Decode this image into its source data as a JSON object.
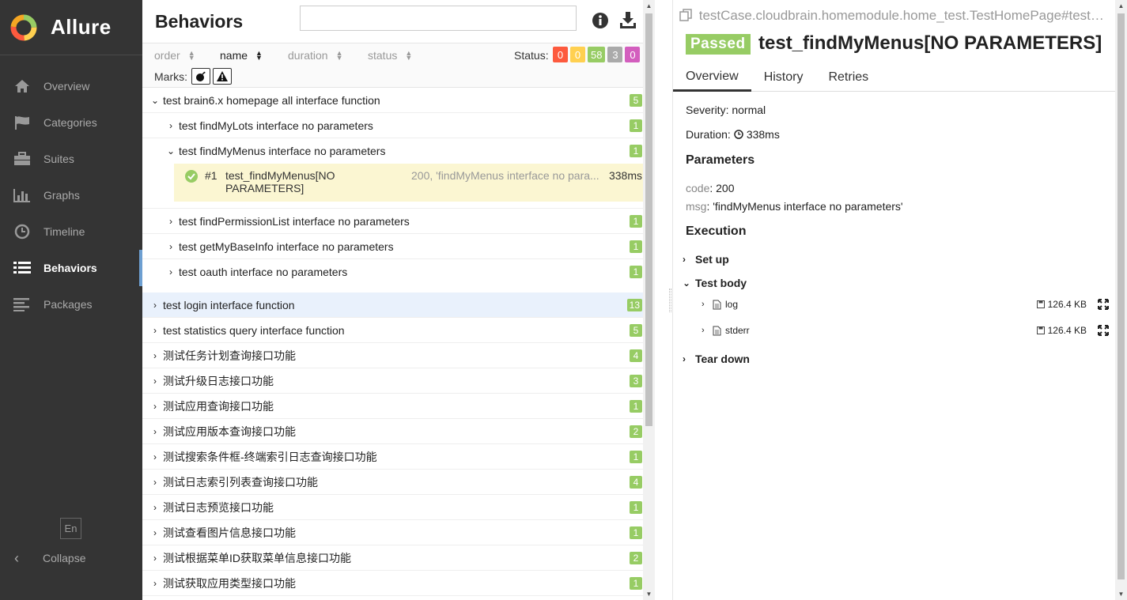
{
  "app": {
    "brand_name": "Allure",
    "brand_colors": {
      "ring_orange": "#f5a623",
      "ring_green": "#97cc64",
      "ring_red": "#fd5a3e",
      "ring_yellow": "#ffd050"
    }
  },
  "sidebar": {
    "items": [
      {
        "label": "Overview",
        "icon": "home-icon",
        "active": false
      },
      {
        "label": "Categories",
        "icon": "flag-icon",
        "active": false
      },
      {
        "label": "Suites",
        "icon": "briefcase-icon",
        "active": false
      },
      {
        "label": "Graphs",
        "icon": "bar-chart-icon",
        "active": false
      },
      {
        "label": "Timeline",
        "icon": "clock-icon",
        "active": false
      },
      {
        "label": "Behaviors",
        "icon": "list-icon",
        "active": true
      },
      {
        "label": "Packages",
        "icon": "align-left-icon",
        "active": false
      }
    ],
    "lang_label": "En",
    "collapse_label": "Collapse"
  },
  "middle": {
    "title": "Behaviors",
    "search_value": "",
    "sort": {
      "order": "order",
      "name": "name",
      "duration": "duration",
      "status": "status"
    },
    "status_label": "Status:",
    "status_counts": [
      {
        "value": "0",
        "color": "#fd5a3e",
        "name": "failed"
      },
      {
        "value": "0",
        "color": "#ffd050",
        "name": "broken"
      },
      {
        "value": "58",
        "color": "#97cc64",
        "name": "passed"
      },
      {
        "value": "3",
        "color": "#aaaaaa",
        "name": "skipped"
      },
      {
        "value": "0",
        "color": "#d35ebe",
        "name": "unknown"
      }
    ],
    "marks_label": "Marks:",
    "tree": {
      "expanded_group": {
        "label": "test brain6.x homepage all interface function",
        "count": "5"
      },
      "sub_items": [
        {
          "label": "test findMyLots interface no parameters",
          "count": "1",
          "expanded": false
        },
        {
          "label": "test findMyMenus interface no parameters",
          "count": "1",
          "expanded": true
        }
      ],
      "test_case": {
        "num": "#1",
        "name": "test_findMyMenus[NO PARAMETERS]",
        "params": "200, 'findMyMenus interface no para...",
        "duration": "338ms"
      },
      "sub_items_after": [
        {
          "label": "test findPermissionList interface no parameters",
          "count": "1"
        },
        {
          "label": "test getMyBaseInfo interface no parameters",
          "count": "1"
        },
        {
          "label": "test oauth interface no parameters",
          "count": "1"
        }
      ],
      "groups": [
        {
          "label": "test login interface function",
          "count": "13",
          "highlight": true
        },
        {
          "label": "test statistics query interface function",
          "count": "5"
        },
        {
          "label": "测试任务计划查询接口功能",
          "count": "4"
        },
        {
          "label": "测试升级日志接口功能",
          "count": "3"
        },
        {
          "label": "测试应用查询接口功能",
          "count": "1"
        },
        {
          "label": "测试应用版本查询接口功能",
          "count": "2"
        },
        {
          "label": "测试搜索条件框-终端索引日志查询接口功能",
          "count": "1"
        },
        {
          "label": "测试日志索引列表查询接口功能",
          "count": "4"
        },
        {
          "label": "测试日志预览接口功能",
          "count": "1"
        },
        {
          "label": "测试查看图片信息接口功能",
          "count": "1"
        },
        {
          "label": "测试根据菜单ID获取菜单信息接口功能",
          "count": "2"
        },
        {
          "label": "测试获取应用类型接口功能",
          "count": "1"
        }
      ]
    }
  },
  "detail": {
    "breadcrumb": "testCase.cloudbrain.homemodule.home_test.TestHomePage#test_findMyMenus",
    "status": "Passed",
    "status_color": "#97cc64",
    "title": "test_findMyMenus[NO PARAMETERS]",
    "tabs": [
      "Overview",
      "History",
      "Retries"
    ],
    "severity_label": "Severity:",
    "severity_value": "normal",
    "duration_label": "Duration:",
    "duration_value": "338ms",
    "parameters_heading": "Parameters",
    "params": [
      {
        "key": "code",
        "value": "200"
      },
      {
        "key": "msg",
        "value": "'findMyMenus interface no parameters'"
      }
    ],
    "execution_heading": "Execution",
    "setup_label": "Set up",
    "body_label": "Test body",
    "attachments": [
      {
        "name": "log",
        "size": "126.4 KB"
      },
      {
        "name": "stderr",
        "size": "126.4 KB"
      }
    ],
    "teardown_label": "Tear down"
  }
}
